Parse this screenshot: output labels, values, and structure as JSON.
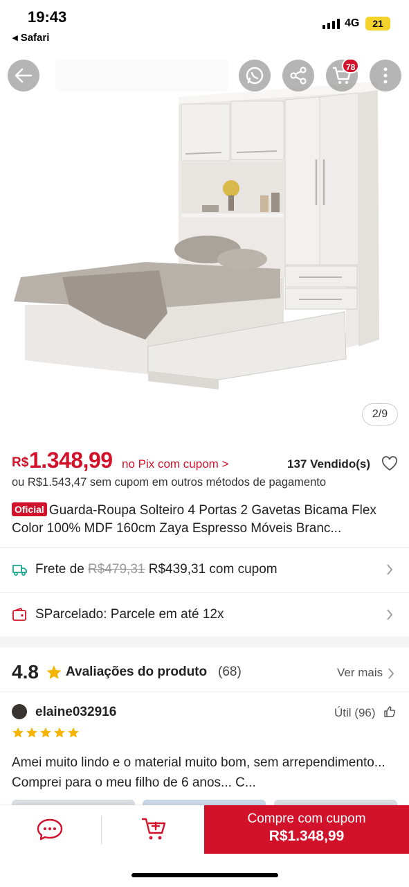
{
  "status_bar": {
    "time": "19:43",
    "back_app": "◂ Safari",
    "network": "4G",
    "battery": "21"
  },
  "header": {
    "cart_count": "78",
    "image_counter": "2/9"
  },
  "price": {
    "currency": "R$",
    "value": "1.348,99",
    "pix_label": "no Pix com cupom >",
    "sold": "137 Vendido(s)",
    "alt_price": "ou R$1.543,47 sem cupom em outros métodos de pagamento"
  },
  "product": {
    "badge": "Oficial",
    "title": "Guarda-Roupa Solteiro 4 Portas 2 Gavetas Bicama Flex Color 100% MDF 160cm Zaya Espresso Móveis Branc..."
  },
  "shipping": {
    "prefix": "Frete de",
    "old_price": "R$479,31",
    "new_price": "R$439,31 com cupom"
  },
  "installments": {
    "label": "SParcelado: Parcele em até 12x"
  },
  "reviews": {
    "rating": "4.8",
    "title": "Avaliações do produto",
    "count": "(68)",
    "see_more": "Ver mais",
    "first": {
      "user": "elaine032916",
      "helpful": "Útil (96)",
      "stars": 5,
      "text": "Amei muito lindo e o material muito bom, sem arrependimento... Comprei para o meu filho de 6 anos... C..."
    }
  },
  "bottom_bar": {
    "buy_line1": "Compre com cupom",
    "buy_line2": "R$1.348,99"
  },
  "colors": {
    "accent": "#d1122a",
    "star": "#f5b400",
    "shipping_icon": "#1aa58c"
  }
}
